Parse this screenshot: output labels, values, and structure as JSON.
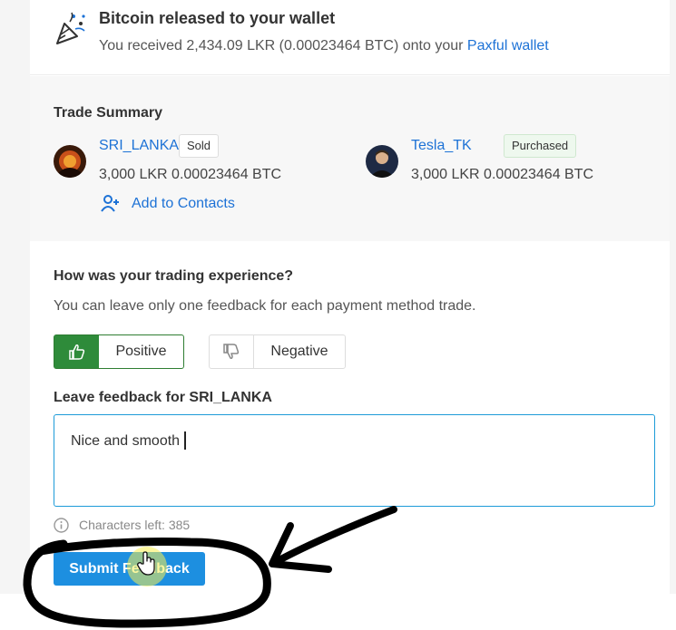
{
  "release": {
    "title": "Bitcoin released to your wallet",
    "text_prefix": "You received 2,434.09 LKR (0.00023464 BTC) onto your ",
    "link": "Paxful wallet",
    "icon": "party-popper-icon"
  },
  "summary": {
    "title": "Trade Summary",
    "seller": {
      "name": "SRI_LANKA",
      "badge": "Sold",
      "amount": "3,000 LKR  0.00023464 BTC"
    },
    "buyer": {
      "name": "Tesla_TK",
      "badge": "Purchased",
      "amount": "3,000 LKR  0.00023464 BTC"
    },
    "add_contacts": "Add to Contacts"
  },
  "feedback": {
    "question": "How was your trading experience?",
    "subtext": "You can leave only one feedback for each payment method trade.",
    "positive_label": "Positive",
    "negative_label": "Negative",
    "leave_label": "Leave feedback for SRI_LANKA",
    "text_value": "Nice and smooth",
    "chars_left": "Characters left: 385",
    "submit_label": "Submit Feedback"
  },
  "colors": {
    "link": "#1d72d6",
    "positive": "#2e8b3a",
    "submit": "#1d8fe0",
    "input_border": "#1d9bd8"
  }
}
